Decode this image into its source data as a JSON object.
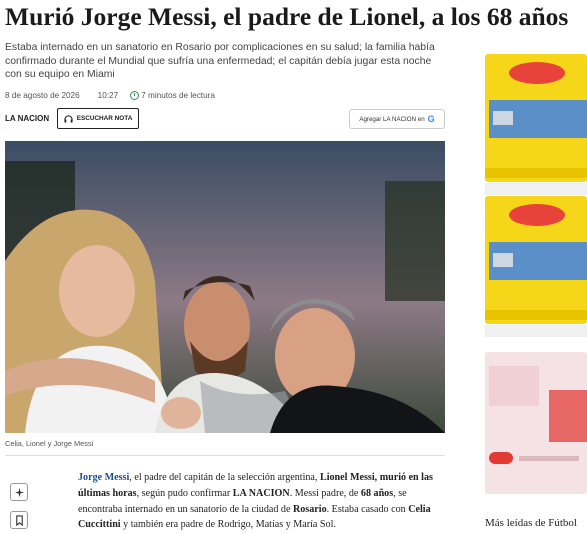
{
  "article": {
    "headline": "Murió Jorge Messi, el padre de Lionel, a los 68 años",
    "dek": "Estaba internado en un sanatorio en Rosario por complicaciones en su salud; la familia había confirmado durante el Mundial que sufría una enfermedad; el capitán debía jugar esta noche con su equipo en Miami",
    "date": "8 de agosto de 2026",
    "time": "10:27",
    "read_time": "7 minutos de lectura",
    "brand": "LA NACION",
    "listen_label": "ESCUCHAR NOTA",
    "google_label": "Agregar LA NACION en",
    "google_glyph": "G",
    "photo_caption": "Celia, Lionel y Jorge Messi",
    "body": {
      "p1": "Jorge Messi",
      "p2": ", el padre del capitán de la selección argentina, ",
      "p3": "Lionel Messi, murió en las últimas horas",
      "p4": ", según pudo confirmar ",
      "p5": "LA NACION",
      "p6": ". Messi padre, de ",
      "p7": "68 años",
      "p8": ", se encontraba internado en un sanatorio de la ciudad de ",
      "p9": "Rosario",
      "p10": ". Estaba casado con ",
      "p11": "Celia Cuccittini",
      "p12": " y también era padre de Rodrigo, Matías y María Sol."
    }
  },
  "sidebar": {
    "icons": [
      "ai-summary-icon",
      "bookmark-icon"
    ],
    "most_read_label": "Más leídas de Fútbol"
  },
  "colors": {
    "link": "#1a4e8c",
    "ad_yellow": "#f6d619",
    "ad_red": "#e8433a",
    "ad_blue": "#5b8fc7",
    "ad_pink": "#f4e2e4"
  }
}
